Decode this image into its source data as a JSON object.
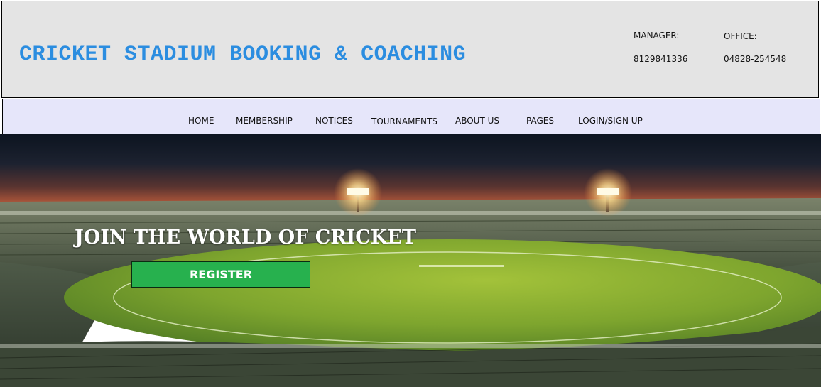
{
  "header": {
    "title": "CRICKET STADIUM BOOKING & COACHING",
    "manager_label": "MANAGER:",
    "manager_phone": "8129841336",
    "office_label": "OFFICE:",
    "office_phone": "04828-254548"
  },
  "nav": {
    "items": [
      {
        "label": "HOME"
      },
      {
        "label": "MEMBERSHIP"
      },
      {
        "label": "NOTICES"
      },
      {
        "label": "TOURNAMENTS"
      },
      {
        "label": "ABOUT US"
      },
      {
        "label": "PAGES"
      },
      {
        "label": "LOGIN/SIGN UP"
      }
    ]
  },
  "hero": {
    "heading": "JOIN THE WORLD OF CRICKET",
    "register_label": "REGISTER"
  },
  "colors": {
    "title_blue": "#2b8de0",
    "header_bg": "#e4e4e4",
    "nav_bg": "#e6e6fa",
    "register_green": "#27b14e"
  }
}
